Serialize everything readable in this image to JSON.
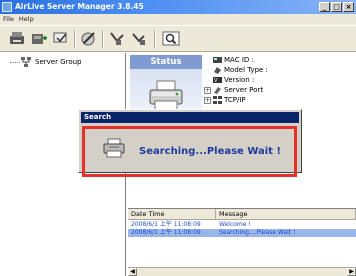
{
  "window": {
    "title": "AirLive Server Manager 3.8.45",
    "controls": {
      "minimize": "_",
      "maximize": "□",
      "close": "×"
    }
  },
  "menu": {
    "items": [
      "File",
      "Help"
    ]
  },
  "toolbar": {
    "buttons": [
      "search-icon",
      "add-server-icon",
      "config-icon",
      "edit-icon",
      "connect-icon",
      "disconnect-icon",
      "find-icon"
    ]
  },
  "tree": {
    "root_label": "Server Group"
  },
  "status": {
    "tab_label": "Status",
    "properties": [
      {
        "label": "MAC ID :",
        "expandable": false,
        "icon": "mac-icon"
      },
      {
        "label": "Model Type :",
        "expandable": false,
        "icon": "model-icon"
      },
      {
        "label": "Version :",
        "expandable": false,
        "icon": "version-icon"
      },
      {
        "label": "Server Port",
        "expandable": true,
        "icon": "port-icon"
      },
      {
        "label": "TCP/IP",
        "expandable": true,
        "icon": "network-icon"
      }
    ]
  },
  "log": {
    "columns": [
      "Date Time",
      "Message"
    ],
    "rows": [
      {
        "datetime": "2008/6/1 上午 11:08:09",
        "message": "Welcome !",
        "selected": false
      },
      {
        "datetime": "2008/6/1 上午 11:08:09",
        "message": "Searching....Please Wait !",
        "selected": true
      }
    ]
  },
  "dialog": {
    "title": "Search",
    "message": "Searching...Please Wait !"
  },
  "colors": {
    "title_bar": "#2a6fe0",
    "dialog_title": "#0a246a",
    "highlight_box": "#e5312c",
    "message_text": "#1e3a9c"
  }
}
